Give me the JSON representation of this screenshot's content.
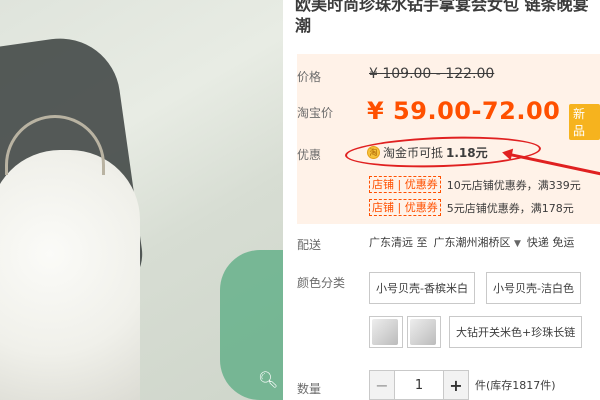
{
  "product": {
    "title": "欧美时尚珍珠水钻手拿宴会女包 链条晚宴",
    "title_line2": "潮"
  },
  "price": {
    "label": "价格",
    "original": "¥ 109.00 - 122.00",
    "taobao_label": "淘宝价",
    "current": "¥ 59.00-72.00",
    "badge": "新品"
  },
  "promo": {
    "label": "优惠",
    "coin_text": "淘金币可抵",
    "coin_amount": "1.18元",
    "coupons": [
      {
        "tag": "店铺 | 优惠券",
        "text": "10元店铺优惠券，满339元"
      },
      {
        "tag": "店铺 | 优惠券",
        "text": "5元店铺优惠券，满178元"
      }
    ]
  },
  "shipping": {
    "label": "配送",
    "from": "广东清远 至",
    "to": "广东潮州湘桥区",
    "method": "快递 免运"
  },
  "sku": {
    "label": "颜色分类",
    "options": [
      "小号贝壳-香槟米白",
      "小号贝壳-洁白色",
      "大钻开关米色+珍珠长链"
    ]
  },
  "quantity": {
    "label": "数量",
    "value": "1",
    "minus": "−",
    "plus": "+",
    "stock": "件(库存1817件)"
  },
  "colors": {
    "accent": "#ff5000",
    "annotation": "#e02020",
    "pricebox_bg": "#fff2e8"
  },
  "icons": {
    "zoom": "magnifier-icon",
    "coin": "coin-icon"
  }
}
